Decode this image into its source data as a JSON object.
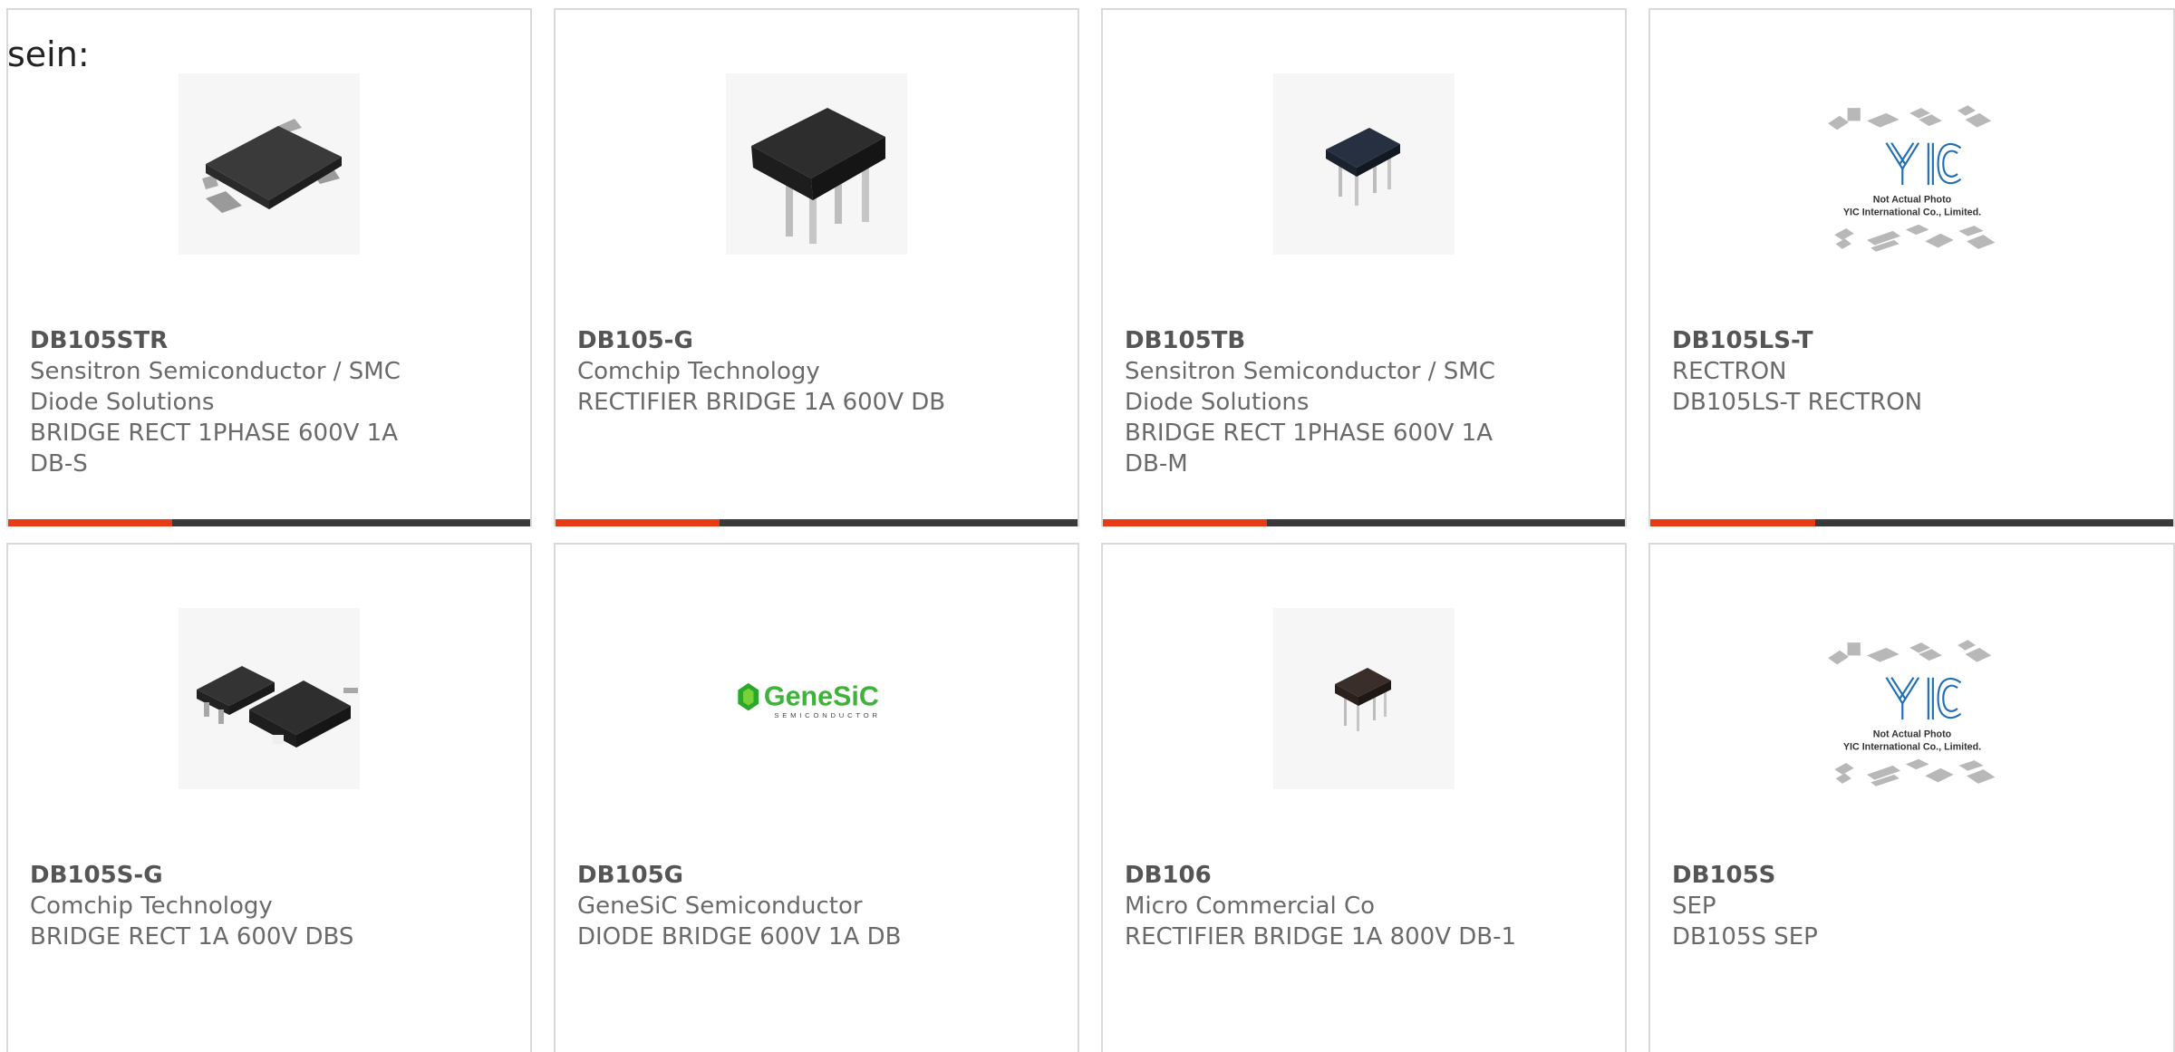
{
  "lead_text": "sein:",
  "products": [
    {
      "part": "DB105STR",
      "lines": [
        "Sensitron Semiconductor / SMC",
        "Diode Solutions",
        "BRIDGE RECT 1PHASE 600V 1A",
        "DB-S"
      ],
      "image": "smd-bridge-photo",
      "has_accent": true
    },
    {
      "part": "DB105-G",
      "lines": [
        "Comchip Technology",
        "RECTIFIER BRIDGE 1A 600V DB"
      ],
      "image": "dip-bridge-photo",
      "has_accent": true
    },
    {
      "part": "DB105TB",
      "lines": [
        "Sensitron Semiconductor / SMC",
        "Diode Solutions",
        "BRIDGE RECT 1PHASE 600V 1A",
        "DB-M"
      ],
      "image": "small-dip-bridge-photo",
      "has_accent": true
    },
    {
      "part": "DB105LS-T",
      "lines": [
        "RECTRON",
        "DB105LS-T RECTRON"
      ],
      "image": "yic-placeholder",
      "has_accent": true
    },
    {
      "part": "DB105S-G",
      "lines": [
        "Comchip Technology",
        "BRIDGE RECT 1A 600V DBS"
      ],
      "image": "smd-pair-photo",
      "has_accent": false
    },
    {
      "part": "DB105G",
      "lines": [
        "GeneSiC Semiconductor",
        "DIODE BRIDGE 600V 1A DB"
      ],
      "image": "genesic-logo",
      "has_accent": false
    },
    {
      "part": "DB106",
      "lines": [
        "Micro Commercial Co",
        "RECTIFIER BRIDGE 1A 800V DB-1"
      ],
      "image": "tiny-dip-bridge-photo",
      "has_accent": false
    },
    {
      "part": "DB105S",
      "lines": [
        "SEP",
        "DB105S SEP"
      ],
      "image": "yic-placeholder",
      "has_accent": false
    }
  ],
  "placeholder": {
    "line1": "Not Actual Photo",
    "line2": "YIC International Co., Limited.",
    "logo": "YIC"
  },
  "genesic": {
    "name": "GeneSiC",
    "sub": "SEMICONDUCTOR"
  },
  "colors": {
    "accent_red": "#e63b14",
    "accent_dark": "#3a3a3a",
    "border": "#d9d9d9",
    "text": "#6a6a6a"
  }
}
